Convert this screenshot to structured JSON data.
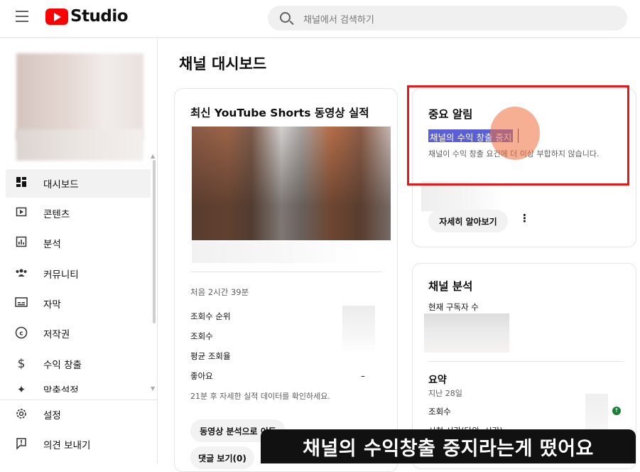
{
  "header": {
    "logo_text": "Studio",
    "search_placeholder": "채널에서 검색하기"
  },
  "sidebar": {
    "items": [
      {
        "label": "대시보드",
        "icon": "dashboard-icon",
        "active": true
      },
      {
        "label": "콘텐츠",
        "icon": "content-icon"
      },
      {
        "label": "분석",
        "icon": "analytics-icon"
      },
      {
        "label": "커뮤니티",
        "icon": "community-icon"
      },
      {
        "label": "자막",
        "icon": "subtitles-icon"
      },
      {
        "label": "저작권",
        "icon": "copyright-icon"
      },
      {
        "label": "수익 창출",
        "icon": "dollar-icon"
      },
      {
        "label": "맞춤설정",
        "icon": "customization-icon"
      }
    ],
    "bottom_items": [
      {
        "label": "설정",
        "icon": "gear-icon"
      },
      {
        "label": "의견 보내기",
        "icon": "feedback-icon"
      }
    ]
  },
  "main": {
    "page_title": "채널 대시보드",
    "shorts_card": {
      "title": "최신 YouTube Shorts 동영상 실적",
      "first_time": "처음 2시간 39분",
      "stats": [
        "조회수 순위",
        "조회수",
        "평균 조회율",
        "좋아요"
      ],
      "likes_value": "–",
      "note": "21분 후 자세한 실적 데이터를 확인하세요.",
      "analytics_button": "동영상 분석으로 이동",
      "comments_button": "댓글 보기(0)"
    },
    "alert_card": {
      "title": "중요 알림",
      "highlight": "채널의 수익 창출 중지",
      "description": "채널이 수익 창출 요건에 더 이상 부합하지 않습니다.",
      "learn_more": "자세히 알아보기",
      "more_icon": "more-vert-icon"
    },
    "analytics_card": {
      "title": "채널 분석",
      "current_subscribers": "현재 구독자 수",
      "summary_title": "요약",
      "summary_period": "지난 28일",
      "views_label": "조회수",
      "watch_time_label": "시청 시간(단위: 시간)"
    }
  },
  "caption": "채널의 수익창출 중지라는게 떴어요",
  "colors": {
    "brand_red": "#ff0000",
    "highlight": "#5a5fd6",
    "annotation_red": "#e81818",
    "caption_bg": "#111111"
  }
}
